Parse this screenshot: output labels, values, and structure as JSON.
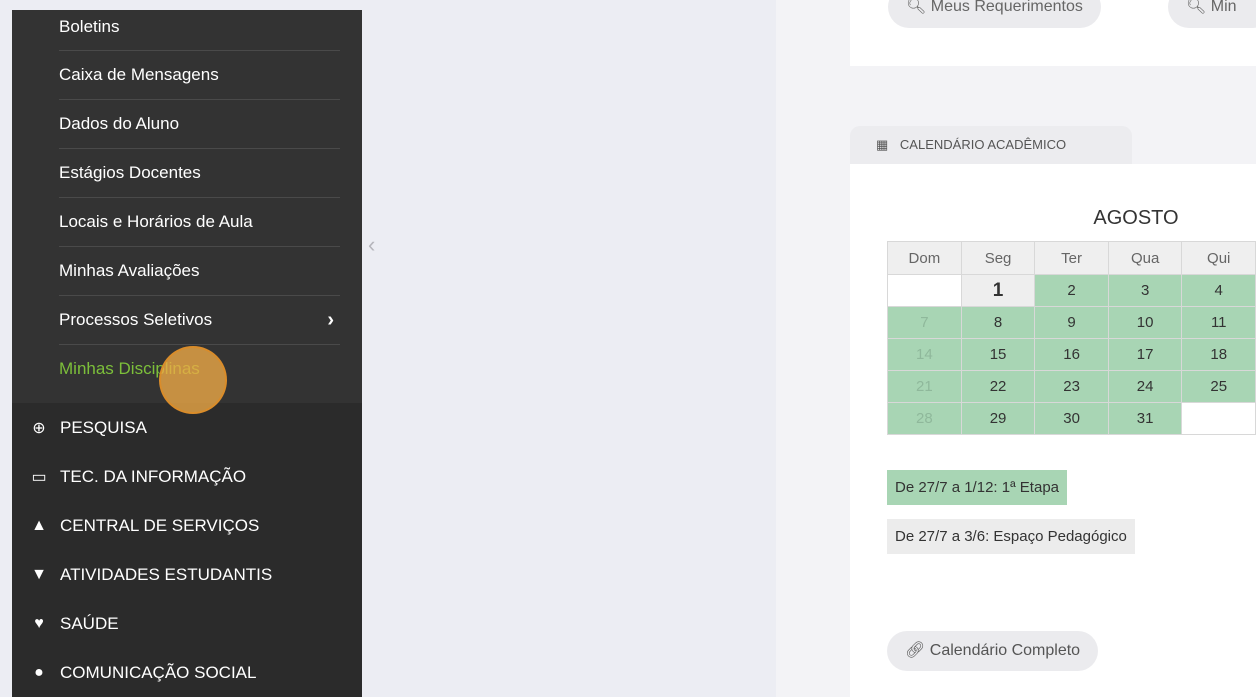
{
  "submenu": [
    {
      "label": "Boletins",
      "arrow": false,
      "active": false
    },
    {
      "label": "Caixa de Mensagens",
      "arrow": false,
      "active": false
    },
    {
      "label": "Dados do Aluno",
      "arrow": false,
      "active": false
    },
    {
      "label": "Estágios Docentes",
      "arrow": false,
      "active": false
    },
    {
      "label": "Locais e Horários de Aula",
      "arrow": false,
      "active": false
    },
    {
      "label": "Minhas Avaliações",
      "arrow": false,
      "active": false
    },
    {
      "label": "Processos Seletivos",
      "arrow": true,
      "active": false
    },
    {
      "label": "Minhas Disciplinas",
      "arrow": false,
      "active": true
    }
  ],
  "submenu_arrow": "›",
  "main_menu": [
    {
      "icon": "globe-icon",
      "glyph": "⊕",
      "label": "PESQUISA"
    },
    {
      "icon": "laptop-icon",
      "glyph": "▭",
      "label": "TEC. DA INFORMAÇÃO"
    },
    {
      "icon": "bell-icon",
      "glyph": "▲",
      "label": "CENTRAL DE SERVIÇOS"
    },
    {
      "icon": "graduation-cap-icon",
      "glyph": "▼",
      "label": "ATIVIDADES ESTUDANTIS"
    },
    {
      "icon": "heartbeat-icon",
      "glyph": "♥",
      "label": "SAÚDE"
    },
    {
      "icon": "comment-icon",
      "glyph": "●",
      "label": "COMUNICAÇÃO SOCIAL"
    }
  ],
  "collapse_glyph": "‹",
  "top_buttons": [
    {
      "icon": "search-icon",
      "glyph": "🔍︎",
      "label": "Meus Requerimentos"
    },
    {
      "icon": "search-icon",
      "glyph": "🔍︎",
      "label": "Min"
    }
  ],
  "calendar": {
    "tab_icon": "calendar-icon",
    "tab_glyph": "▦",
    "title": "CALENDÁRIO ACADÊMICO",
    "month": "AGOSTO",
    "weekdays": [
      "Dom",
      "Seg",
      "Ter",
      "Qua",
      "Qui"
    ],
    "weeks": [
      [
        {
          "d": "",
          "t": "empty"
        },
        {
          "d": "1",
          "t": "today"
        },
        {
          "d": "2",
          "t": "green"
        },
        {
          "d": "3",
          "t": "green"
        },
        {
          "d": "4",
          "t": "green"
        }
      ],
      [
        {
          "d": "7",
          "t": "sun"
        },
        {
          "d": "8",
          "t": "green"
        },
        {
          "d": "9",
          "t": "green"
        },
        {
          "d": "10",
          "t": "green"
        },
        {
          "d": "11",
          "t": "green"
        }
      ],
      [
        {
          "d": "14",
          "t": "sun"
        },
        {
          "d": "15",
          "t": "green"
        },
        {
          "d": "16",
          "t": "green"
        },
        {
          "d": "17",
          "t": "green"
        },
        {
          "d": "18",
          "t": "green"
        }
      ],
      [
        {
          "d": "21",
          "t": "sun"
        },
        {
          "d": "22",
          "t": "green"
        },
        {
          "d": "23",
          "t": "green"
        },
        {
          "d": "24",
          "t": "green"
        },
        {
          "d": "25",
          "t": "green"
        }
      ],
      [
        {
          "d": "28",
          "t": "sun"
        },
        {
          "d": "29",
          "t": "green"
        },
        {
          "d": "30",
          "t": "green"
        },
        {
          "d": "31",
          "t": "green"
        },
        {
          "d": "",
          "t": "empty"
        }
      ]
    ],
    "legend": [
      {
        "label": "De 27/7 a 1/12: 1ª Etapa",
        "color": "#a8d5b4"
      },
      {
        "label": "De 27/7 a 3/6: Espaço Pedagógico",
        "color": "#ececec"
      }
    ],
    "full_button": {
      "icon": "link-icon",
      "glyph": "🔗︎",
      "label": "Calendário Completo"
    }
  }
}
